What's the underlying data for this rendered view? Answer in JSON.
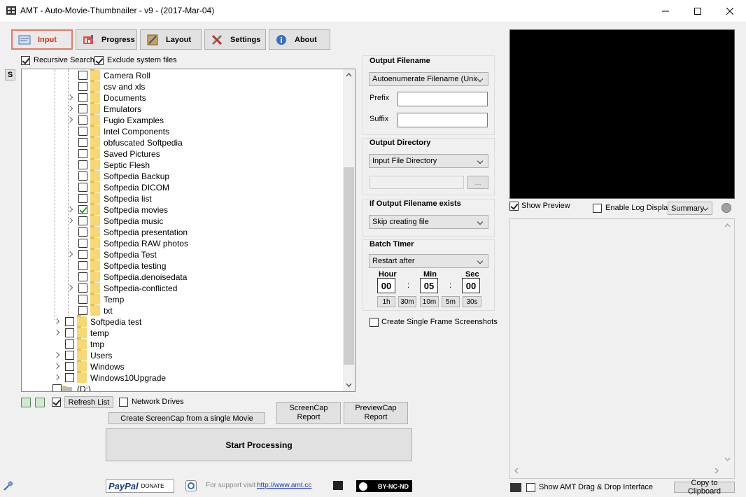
{
  "window": {
    "title": "AMT - Auto-Movie-Thumbnailer - v9 - (2017-Mar-04)"
  },
  "tabs": [
    {
      "label": "Input",
      "icon": "input-icon"
    },
    {
      "label": "Progress",
      "icon": "progress-icon"
    },
    {
      "label": "Layout",
      "icon": "layout-icon"
    },
    {
      "label": "Settings",
      "icon": "settings-icon"
    },
    {
      "label": "About",
      "icon": "about-icon"
    }
  ],
  "options": {
    "recursive_search": "Recursive Search",
    "exclude_system": "Exclude system files",
    "s_button": "S"
  },
  "tree": {
    "items": [
      {
        "name": "Camera Roll",
        "checked": false,
        "expand": false,
        "level": 2
      },
      {
        "name": "csv and xls",
        "checked": false,
        "expand": false,
        "level": 2
      },
      {
        "name": "Documents",
        "checked": false,
        "expand": true,
        "level": 2
      },
      {
        "name": "Emulators",
        "checked": false,
        "expand": true,
        "level": 2
      },
      {
        "name": "Fugio Examples",
        "checked": false,
        "expand": true,
        "level": 2
      },
      {
        "name": "Intel Components",
        "checked": false,
        "expand": false,
        "level": 2
      },
      {
        "name": "obfuscated Softpedia",
        "checked": false,
        "expand": false,
        "level": 2
      },
      {
        "name": "Saved Pictures",
        "checked": false,
        "expand": false,
        "level": 2
      },
      {
        "name": "Septic Flesh",
        "checked": false,
        "expand": false,
        "level": 2
      },
      {
        "name": "Softpedia Backup",
        "checked": false,
        "expand": false,
        "level": 2
      },
      {
        "name": "Softpedia DICOM",
        "checked": false,
        "expand": false,
        "level": 2
      },
      {
        "name": "Softpedia list",
        "checked": false,
        "expand": false,
        "level": 2
      },
      {
        "name": "Softpedia movies",
        "checked": true,
        "expand": true,
        "level": 2
      },
      {
        "name": "Softpedia music",
        "checked": false,
        "expand": true,
        "level": 2
      },
      {
        "name": "Softpedia presentation",
        "checked": false,
        "expand": false,
        "level": 2
      },
      {
        "name": "Softpedia RAW photos",
        "checked": false,
        "expand": false,
        "level": 2
      },
      {
        "name": "Softpedia Test",
        "checked": false,
        "expand": true,
        "level": 2
      },
      {
        "name": "Softpedia testing",
        "checked": false,
        "expand": false,
        "level": 2
      },
      {
        "name": "Softpedia.denoisedata",
        "checked": false,
        "expand": false,
        "level": 2
      },
      {
        "name": "Softpedia-conflicted",
        "checked": false,
        "expand": true,
        "level": 2
      },
      {
        "name": "Temp",
        "checked": false,
        "expand": false,
        "level": 2
      },
      {
        "name": "txt",
        "checked": false,
        "expand": false,
        "level": 2
      },
      {
        "name": "Softpedia test",
        "checked": false,
        "expand": true,
        "level": 1
      },
      {
        "name": "temp",
        "checked": false,
        "expand": true,
        "level": 1
      },
      {
        "name": "tmp",
        "checked": false,
        "expand": false,
        "level": 1
      },
      {
        "name": "Users",
        "checked": false,
        "expand": true,
        "level": 1
      },
      {
        "name": "Windows",
        "checked": false,
        "expand": true,
        "level": 1
      },
      {
        "name": "Windows10Upgrade",
        "checked": false,
        "expand": true,
        "level": 1
      },
      {
        "name": "(D:)",
        "checked": false,
        "expand": false,
        "level": 0
      }
    ]
  },
  "bottom_left": {
    "refresh": "Refresh List",
    "network_drives": "Network Drives",
    "create_single": "Create ScreenCap from a single Movie",
    "screencap_report_1": "ScreenCap",
    "screencap_report_2": "Report",
    "previewcap_report_1": "PreviewCap",
    "previewcap_report_2": "Report",
    "start": "Start Processing"
  },
  "output_filename": {
    "title": "Output Filename",
    "mode": "Autoenumerate Filename (Unique",
    "prefix_label": "Prefix",
    "suffix_label": "Suffix",
    "prefix_value": "",
    "suffix_value": ""
  },
  "output_directory": {
    "title": "Output Directory",
    "mode": "Input File Directory",
    "path": "",
    "browse": "..."
  },
  "if_exists": {
    "title": "If Output Filename exists",
    "mode": "Skip creating file"
  },
  "batch_timer": {
    "title": "Batch Timer",
    "mode": "Restart after",
    "hour_label": "Hour",
    "min_label": "Min",
    "sec_label": "Sec",
    "hour": "00",
    "min": "05",
    "sec": "00",
    "sep": ":",
    "presets": [
      "1h",
      "30m",
      "10m",
      "5m",
      "30s"
    ]
  },
  "single_frame": "Create Single Frame Screenshots",
  "preview": {
    "show_preview": "Show Preview",
    "enable_log": "Enable Log Display",
    "log_mode": "Summary"
  },
  "footer": {
    "paypal": "PayPal",
    "donate": "DONATE",
    "support_text": "For support visit",
    "support_link": "http://www.amt.cc",
    "license": "BY-NC-ND",
    "drag_drop": "Show AMT Drag & Drop Interface",
    "copy": "Copy to Clipboard"
  },
  "colors": {
    "active_tab": "#d03020",
    "preview_bg": "#000000",
    "folder": "#f8d775"
  }
}
